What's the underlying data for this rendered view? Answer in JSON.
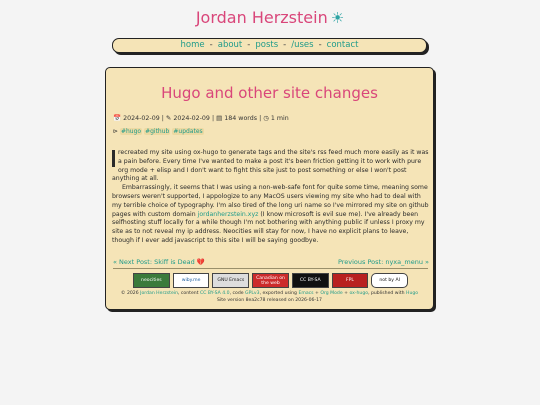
{
  "site": {
    "title": "Jordan Herzstein",
    "title_icon": "sun-icon"
  },
  "nav": {
    "items": [
      "home",
      "about",
      "posts",
      "/uses",
      "contact"
    ],
    "separator": "-"
  },
  "post": {
    "title": "Hugo and other site changes",
    "created": "2024-02-09",
    "modified": "2024-02-09",
    "word_count": "184 words",
    "read_time": "1 min",
    "meta_sep": "|",
    "tags": [
      "#hugo",
      "#github",
      "#updates"
    ],
    "para1": "recreated my site using ox-hugo to generate tags and the site's rss feed much more easily as it was a pain before. Every time I've wanted to make a post it's been friction getting it to work with pure org mode + elisp and I don't want to fight this site just to post something or else I won't post anything at all.",
    "para2_a": "Embarrassingly, it seems that I was using a non-web-safe font for quite some time, meaning some browsers weren't supported, I appologize to any MacOS users viewing my site who had to deal with my terrible choice of typography. I'm also tired of the long uri name so I've mirrored my site on github pages with custom domain ",
    "para2_link": "jordanherzstein.xyz",
    "para2_b": " (I know microsoft is evil sue me). I've already been selfhosting stuff locally for a while though I'm not bothering with anything public if unless I proxy my site as to not reveal my ip address. Neocities will stay for now, I have no explicit plans to leave, though if I ever add javascript to this site I will be saying goodbye."
  },
  "post_nav": {
    "next": "« Next Post: Skiff is Dead ",
    "next_icon": "broken-heart-icon",
    "previous": "Previous Post: nyxa_menu »"
  },
  "badges": [
    "neocities",
    "wiby.me",
    "GNU Emacs",
    "Canadian on the web",
    "CC BY-SA",
    "FPL",
    "not by AI"
  ],
  "footer": {
    "line1_a": "© 2026 ",
    "author": "Jordan Herzstein",
    "line1_b": ", content ",
    "license_content": "CC BY-SA 4.0",
    "line1_c": ", code ",
    "license_code": "GPLv3",
    "line1_d": ", exported using ",
    "tool1": "Emacs",
    "tool_sep1": " + ",
    "tool2": "Org Mode",
    "tool_sep2": " + ",
    "tool3": "ox-hugo",
    "line1_e": ", published with ",
    "tool4": "Hugo",
    "line2": "Site version 8ea2c78 released on 2026-06-17"
  }
}
